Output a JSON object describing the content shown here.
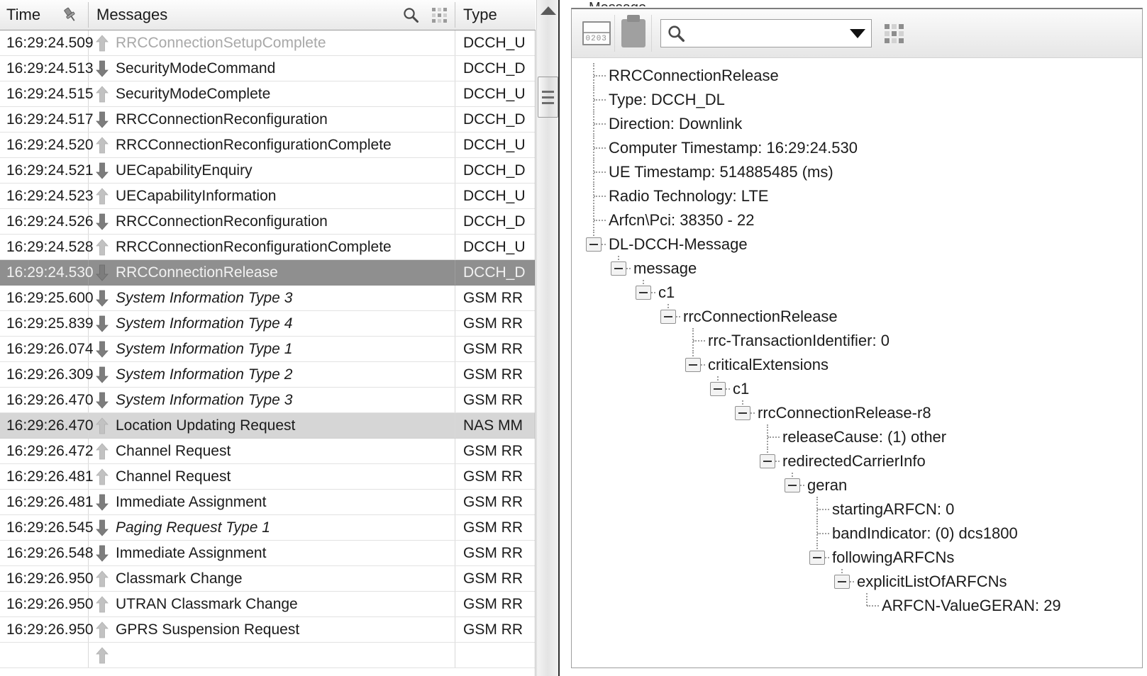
{
  "window": {
    "clipped_title": "Message",
    "accent_selection": "#8f8f8f",
    "accent_soft_selection": "#d6d6d6"
  },
  "message_grid": {
    "columns": [
      {
        "key": "time",
        "label": "Time"
      },
      {
        "key": "messages",
        "label": "Messages"
      },
      {
        "key": "type",
        "label": "Type"
      }
    ],
    "header_icons": [
      {
        "name": "pin-icon",
        "glyph": "pin"
      },
      {
        "name": "search-icon",
        "glyph": "magnifier"
      },
      {
        "name": "grid-icon",
        "glyph": "grid-3x3"
      }
    ],
    "rows": [
      {
        "time": "16:29:24.509",
        "dir": "up",
        "message": "RRCConnectionSetupComplete",
        "type": "DCCH_U",
        "style": "dim",
        "state": "normal"
      },
      {
        "time": "16:29:24.513",
        "dir": "down",
        "message": "SecurityModeCommand",
        "type": "DCCH_D",
        "style": "normal",
        "state": "normal"
      },
      {
        "time": "16:29:24.515",
        "dir": "up",
        "message": "SecurityModeComplete",
        "type": "DCCH_U",
        "style": "normal",
        "state": "normal"
      },
      {
        "time": "16:29:24.517",
        "dir": "down",
        "message": "RRCConnectionReconfiguration",
        "type": "DCCH_D",
        "style": "normal",
        "state": "normal"
      },
      {
        "time": "16:29:24.520",
        "dir": "up",
        "message": "RRCConnectionReconfigurationComplete",
        "type": "DCCH_U",
        "style": "normal",
        "state": "normal"
      },
      {
        "time": "16:29:24.521",
        "dir": "down",
        "message": "UECapabilityEnquiry",
        "type": "DCCH_D",
        "style": "normal",
        "state": "normal"
      },
      {
        "time": "16:29:24.523",
        "dir": "up",
        "message": "UECapabilityInformation",
        "type": "DCCH_U",
        "style": "normal",
        "state": "normal"
      },
      {
        "time": "16:29:24.526",
        "dir": "down",
        "message": "RRCConnectionReconfiguration",
        "type": "DCCH_D",
        "style": "normal",
        "state": "normal"
      },
      {
        "time": "16:29:24.528",
        "dir": "up",
        "message": "RRCConnectionReconfigurationComplete",
        "type": "DCCH_U",
        "style": "normal",
        "state": "normal"
      },
      {
        "time": "16:29:24.530",
        "dir": "down",
        "message": "RRCConnectionRelease",
        "type": "DCCH_D",
        "style": "normal",
        "state": "selected"
      },
      {
        "time": "16:29:25.600",
        "dir": "down",
        "message": "System Information Type 3",
        "type": "GSM RR",
        "style": "italic",
        "state": "normal"
      },
      {
        "time": "16:29:25.839",
        "dir": "down",
        "message": "System Information Type 4",
        "type": "GSM RR",
        "style": "italic",
        "state": "normal"
      },
      {
        "time": "16:29:26.074",
        "dir": "down",
        "message": "System Information Type 1",
        "type": "GSM RR",
        "style": "italic",
        "state": "normal"
      },
      {
        "time": "16:29:26.309",
        "dir": "down",
        "message": "System Information Type 2",
        "type": "GSM RR",
        "style": "italic",
        "state": "normal"
      },
      {
        "time": "16:29:26.470",
        "dir": "down",
        "message": "System Information Type 3",
        "type": "GSM RR",
        "style": "italic",
        "state": "normal"
      },
      {
        "time": "16:29:26.470",
        "dir": "up",
        "message": "Location Updating Request",
        "type": "NAS MM",
        "style": "normal",
        "state": "soft-selected"
      },
      {
        "time": "16:29:26.472",
        "dir": "up",
        "message": "Channel Request",
        "type": "GSM RR",
        "style": "normal",
        "state": "normal"
      },
      {
        "time": "16:29:26.481",
        "dir": "up",
        "message": "Channel Request",
        "type": "GSM RR",
        "style": "normal",
        "state": "normal"
      },
      {
        "time": "16:29:26.481",
        "dir": "down",
        "message": "Immediate Assignment",
        "type": "GSM RR",
        "style": "normal",
        "state": "normal"
      },
      {
        "time": "16:29:26.545",
        "dir": "down",
        "message": "Paging Request Type 1",
        "type": "GSM RR",
        "style": "italic",
        "state": "normal"
      },
      {
        "time": "16:29:26.548",
        "dir": "down",
        "message": "Immediate Assignment",
        "type": "GSM RR",
        "style": "normal",
        "state": "normal"
      },
      {
        "time": "16:29:26.950",
        "dir": "up",
        "message": "Classmark Change",
        "type": "GSM RR",
        "style": "normal",
        "state": "normal"
      },
      {
        "time": "16:29:26.950",
        "dir": "up",
        "message": "UTRAN Classmark Change",
        "type": "GSM RR",
        "style": "normal",
        "state": "normal"
      },
      {
        "time": "16:29:26.950",
        "dir": "up",
        "message": "GPRS Suspension Request",
        "type": "GSM RR",
        "style": "normal",
        "state": "normal"
      },
      {
        "time": "",
        "dir": "up",
        "message": "",
        "type": "",
        "style": "normal",
        "state": "normal"
      }
    ]
  },
  "detail_panel": {
    "toolbar": {
      "hex_view_label": "0203",
      "buttons": [
        {
          "name": "hex-view-button",
          "icon": "hex-view-icon"
        },
        {
          "name": "copy-to-clipboard-button",
          "icon": "clipboard-icon"
        }
      ],
      "search": {
        "value": "",
        "placeholder": ""
      },
      "grid_icon": "grid-3x3-icon"
    },
    "tree": [
      {
        "depth": 0,
        "expander": false,
        "label": "RRCConnectionRelease"
      },
      {
        "depth": 0,
        "expander": false,
        "label": "Type: DCCH_DL"
      },
      {
        "depth": 0,
        "expander": false,
        "label": "Direction: Downlink"
      },
      {
        "depth": 0,
        "expander": false,
        "label": "Computer Timestamp: 16:29:24.530"
      },
      {
        "depth": 0,
        "expander": false,
        "label": "UE Timestamp: 514885485 (ms)"
      },
      {
        "depth": 0,
        "expander": false,
        "label": "Radio Technology: LTE"
      },
      {
        "depth": 0,
        "expander": false,
        "label": "Arfcn\\Pci: 38350 - 22"
      },
      {
        "depth": 0,
        "expander": true,
        "label": "DL-DCCH-Message",
        "last": true
      },
      {
        "depth": 1,
        "expander": true,
        "label": "message",
        "last": true
      },
      {
        "depth": 2,
        "expander": true,
        "label": "c1",
        "last": true
      },
      {
        "depth": 3,
        "expander": true,
        "label": "rrcConnectionRelease",
        "last": true
      },
      {
        "depth": 4,
        "expander": false,
        "label": "rrc-TransactionIdentifier: 0"
      },
      {
        "depth": 4,
        "expander": true,
        "label": "criticalExtensions",
        "last": true
      },
      {
        "depth": 5,
        "expander": true,
        "label": "c1",
        "last": true
      },
      {
        "depth": 6,
        "expander": true,
        "label": "rrcConnectionRelease-r8",
        "last": true
      },
      {
        "depth": 7,
        "expander": false,
        "label": "releaseCause: (1) other"
      },
      {
        "depth": 7,
        "expander": true,
        "label": "redirectedCarrierInfo",
        "last": true
      },
      {
        "depth": 8,
        "expander": true,
        "label": "geran",
        "last": true
      },
      {
        "depth": 9,
        "expander": false,
        "label": "startingARFCN: 0"
      },
      {
        "depth": 9,
        "expander": false,
        "label": "bandIndicator: (0) dcs1800"
      },
      {
        "depth": 9,
        "expander": true,
        "label": "followingARFCNs",
        "last": true
      },
      {
        "depth": 10,
        "expander": true,
        "label": "explicitListOfARFCNs",
        "last": true
      },
      {
        "depth": 11,
        "expander": false,
        "label": "ARFCN-ValueGERAN: 29",
        "last": true
      }
    ]
  },
  "scrollbar": {
    "up_arrow": "triangle-up-icon",
    "thumb_grip": "grip-lines-icon"
  }
}
